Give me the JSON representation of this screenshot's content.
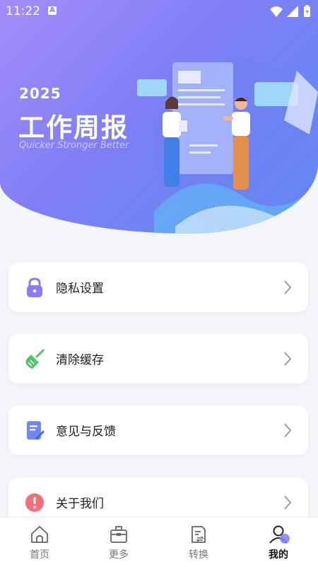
{
  "status_bar": {
    "time": "11:22",
    "indicator": "A"
  },
  "header": {
    "year": "2025",
    "title": "工作周报",
    "subtitle": "Quicker Stronger Better"
  },
  "menu": {
    "items": [
      {
        "label": "隐私设置",
        "icon": "lock-icon",
        "color": "#8b7cf6"
      },
      {
        "label": "清除缓存",
        "icon": "broom-icon",
        "color": "#4cc76b"
      },
      {
        "label": "意见与反馈",
        "icon": "edit-note-icon",
        "color": "#6f86f5"
      },
      {
        "label": "关于我们",
        "icon": "info-icon",
        "color": "#f2707a"
      }
    ]
  },
  "tabbar": {
    "tabs": [
      {
        "label": "首页",
        "icon": "home-icon"
      },
      {
        "label": "更多",
        "icon": "box-icon"
      },
      {
        "label": "转换",
        "icon": "convert-doc-icon"
      },
      {
        "label": "我的",
        "icon": "user-icon"
      }
    ],
    "active_index": 3
  },
  "colors": {
    "accent": "#7f7ef6",
    "background": "#f5f6fa"
  }
}
